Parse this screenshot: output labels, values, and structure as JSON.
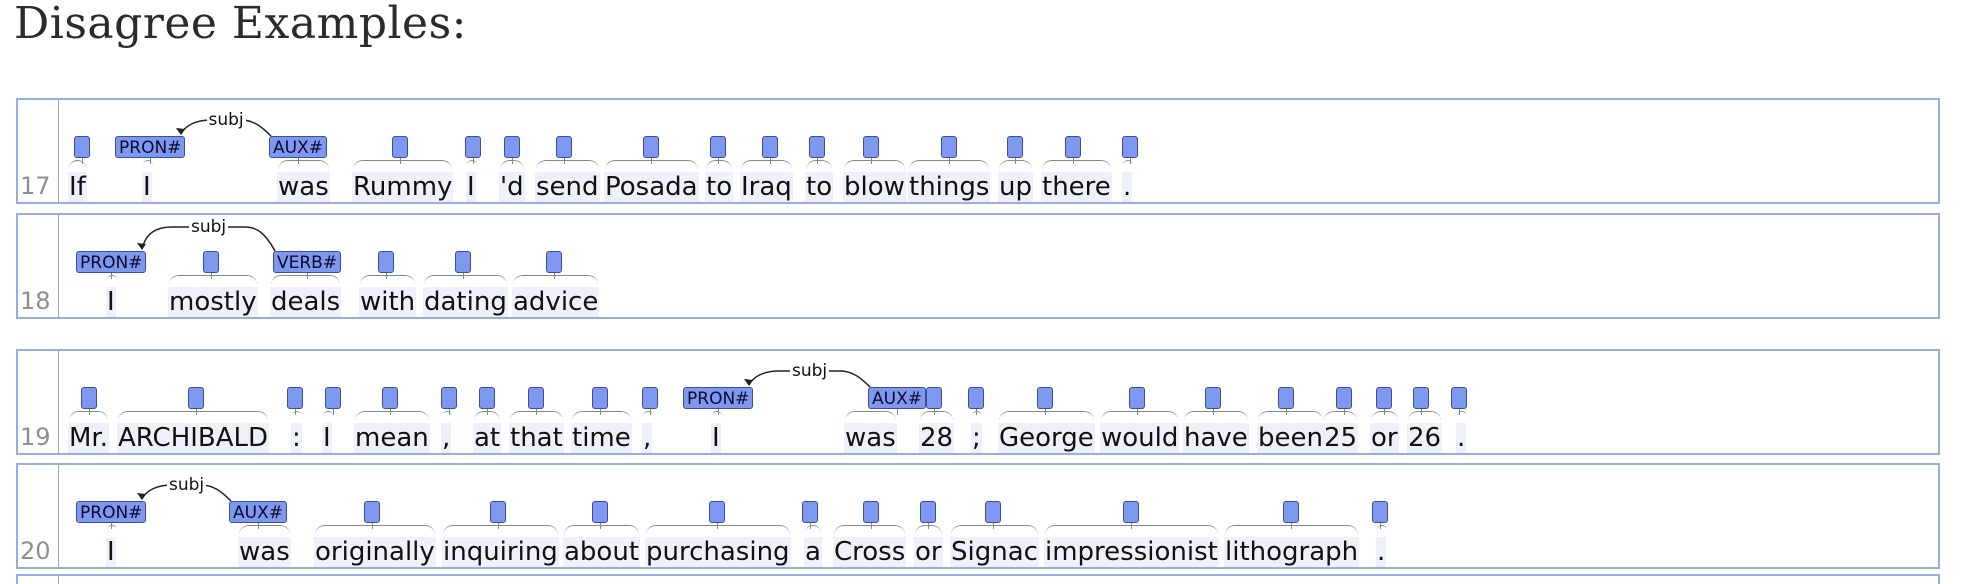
{
  "heading": "Disagree Examples:",
  "rows": [
    {
      "num": "17",
      "tokens": [
        "If",
        "I",
        "was",
        "Rummy",
        "I",
        "'d",
        "send",
        "Posada",
        "to",
        "Iraq",
        "to",
        "blow",
        "things",
        "up",
        "there",
        "."
      ],
      "tags": [
        "",
        "PRON#",
        "AUX#",
        "",
        "",
        "",
        "",
        "",
        "",
        "",
        "",
        "",
        "",
        "",
        "",
        ""
      ],
      "arc_label": "subj"
    },
    {
      "num": "18",
      "tokens": [
        "I",
        "mostly",
        "deals",
        "with",
        "dating",
        "advice"
      ],
      "tags": [
        "PRON#",
        "",
        "VERB#",
        "",
        "",
        ""
      ],
      "arc_label": "subj"
    },
    {
      "num": "19",
      "tokens": [
        "Mr.",
        "ARCHIBALD",
        ":",
        "I",
        "mean",
        ",",
        "at",
        "that",
        "time",
        ",",
        "I",
        "was",
        "28",
        ";",
        "George",
        "would",
        "have",
        "been",
        "25",
        "or",
        "26",
        "."
      ],
      "tags": [
        "",
        "",
        "",
        "",
        "",
        "",
        "",
        "",
        "",
        "",
        "PRON#",
        "AUX#",
        "",
        "",
        "",
        "",
        "",
        "",
        "",
        "",
        "",
        ""
      ],
      "arc_label": "subj"
    },
    {
      "num": "20",
      "tokens": [
        "I",
        "was",
        "originally",
        "inquiring",
        "about",
        "purchasing",
        "a",
        "Cross",
        "or",
        "Signac",
        "impressionist",
        "lithograph",
        "."
      ],
      "tags": [
        "PRON#",
        "AUX#",
        "",
        "",
        "",
        "",
        "",
        "",
        "",
        "",
        "",
        "",
        ""
      ],
      "arc_label": "subj"
    }
  ]
}
